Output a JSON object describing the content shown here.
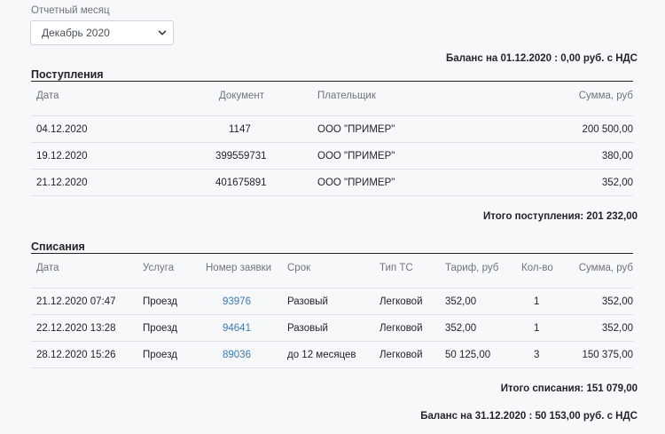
{
  "filter": {
    "label": "Отчетный месяц",
    "selected": "Декабрь 2020"
  },
  "balance_start": "Баланс на 01.12.2020 : 0,00 руб. с НДС",
  "income": {
    "title": "Поступления",
    "headers": {
      "date": "Дата",
      "doc": "Документ",
      "payer": "Плательщик",
      "sum": "Сумма, руб"
    },
    "rows": [
      {
        "date": "04.12.2020",
        "doc": "1147",
        "payer": "ООО \"ПРИМЕР\"",
        "sum": "200 500,00"
      },
      {
        "date": "19.12.2020",
        "doc": "399559731",
        "payer": "ООО \"ПРИМЕР\"",
        "sum": "380,00"
      },
      {
        "date": "21.12.2020",
        "doc": "401675891",
        "payer": "ООО \"ПРИМЕР\"",
        "sum": "352,00"
      }
    ],
    "total": "Итого поступления: 201 232,00"
  },
  "charges": {
    "title": "Списания",
    "headers": {
      "date": "Дата",
      "service": "Услуга",
      "order": "Номер заявки",
      "term": "Срок",
      "vehicle": "Тип ТС",
      "tariff": "Тариф, руб",
      "qty": "Кол-во",
      "sum": "Сумма, руб"
    },
    "rows": [
      {
        "date": "21.12.2020 07:47",
        "service": "Проезд",
        "order": "93976",
        "term": "Разовый",
        "vehicle": "Легковой",
        "tariff": "352,00",
        "qty": "1",
        "sum": "352,00"
      },
      {
        "date": "22.12.2020 13:28",
        "service": "Проезд",
        "order": "94641",
        "term": "Разовый",
        "vehicle": "Легковой",
        "tariff": "352,00",
        "qty": "1",
        "sum": "352,00"
      },
      {
        "date": "28.12.2020 15:26",
        "service": "Проезд",
        "order": "89036",
        "term": "до 12 месяцев",
        "vehicle": "Легковой",
        "tariff": "50 125,00",
        "qty": "3",
        "sum": "150 375,00"
      }
    ],
    "total": "Итого списания: 151 079,00"
  },
  "balance_end": "Баланс на 31.12.2020 : 50 153,00 руб. с НДС"
}
